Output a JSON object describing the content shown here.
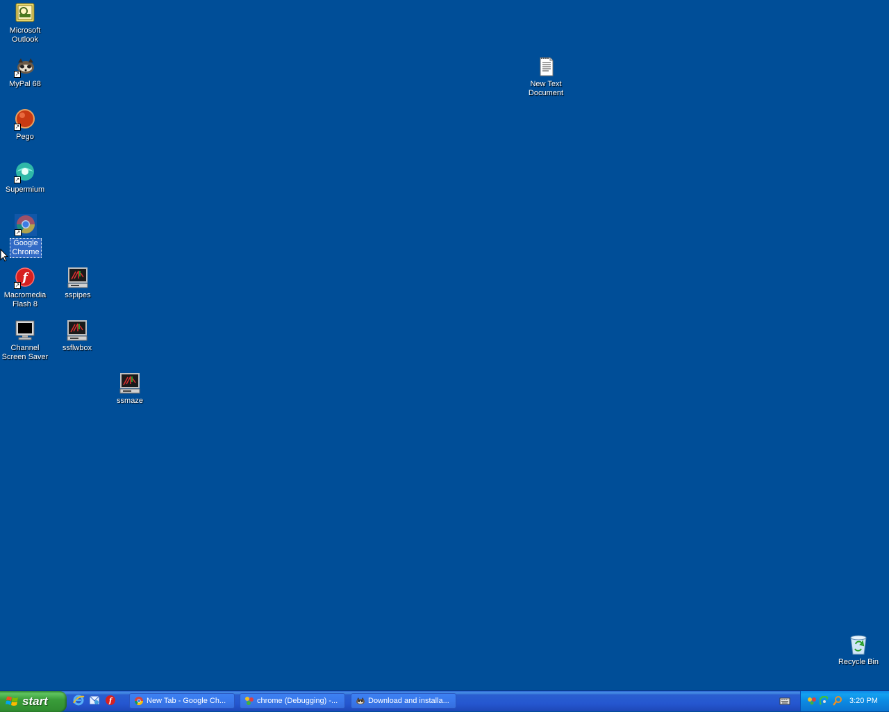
{
  "desktop": {
    "icons": [
      {
        "label": "Microsoft\nOutlook",
        "icon": "outlook-icon"
      },
      {
        "label": "MyPal 68",
        "icon": "mypal-icon"
      },
      {
        "label": "Pego",
        "icon": "pego-icon"
      },
      {
        "label": "Supermium",
        "icon": "supermium-icon"
      },
      {
        "label": "Google\nChrome",
        "icon": "chrome-icon"
      },
      {
        "label": "Macromedia\nFlash 8",
        "icon": "flash-icon"
      },
      {
        "label": "sspipes",
        "icon": "screensaver-icon"
      },
      {
        "label": "Channel\nScreen Saver",
        "icon": "monitor-icon"
      },
      {
        "label": "ssflwbox",
        "icon": "screensaver-icon"
      },
      {
        "label": "ssmaze",
        "icon": "screensaver-icon"
      },
      {
        "label": "New Text\nDocument",
        "icon": "text-document-icon"
      },
      {
        "label": "Recycle Bin",
        "icon": "recycle-bin-icon"
      }
    ]
  },
  "taskbar": {
    "start_label": "start",
    "quick_launch": [
      "internet-explorer-icon",
      "outlook-express-icon",
      "flash-icon"
    ],
    "tasks": [
      {
        "label": "New Tab - Google Ch...",
        "icon": "chrome-icon"
      },
      {
        "label": "chrome (Debugging) -...",
        "icon": "debugger-icon"
      },
      {
        "label": "Download and installa...",
        "icon": "mypal-icon"
      }
    ],
    "clock": "3:20 PM"
  },
  "colors": {
    "desktop_bg": "#004e98",
    "taskbar": "#245edb",
    "start_green": "#3a9d3a",
    "tray": "#0c8ae2",
    "selection": "#316ac5"
  }
}
